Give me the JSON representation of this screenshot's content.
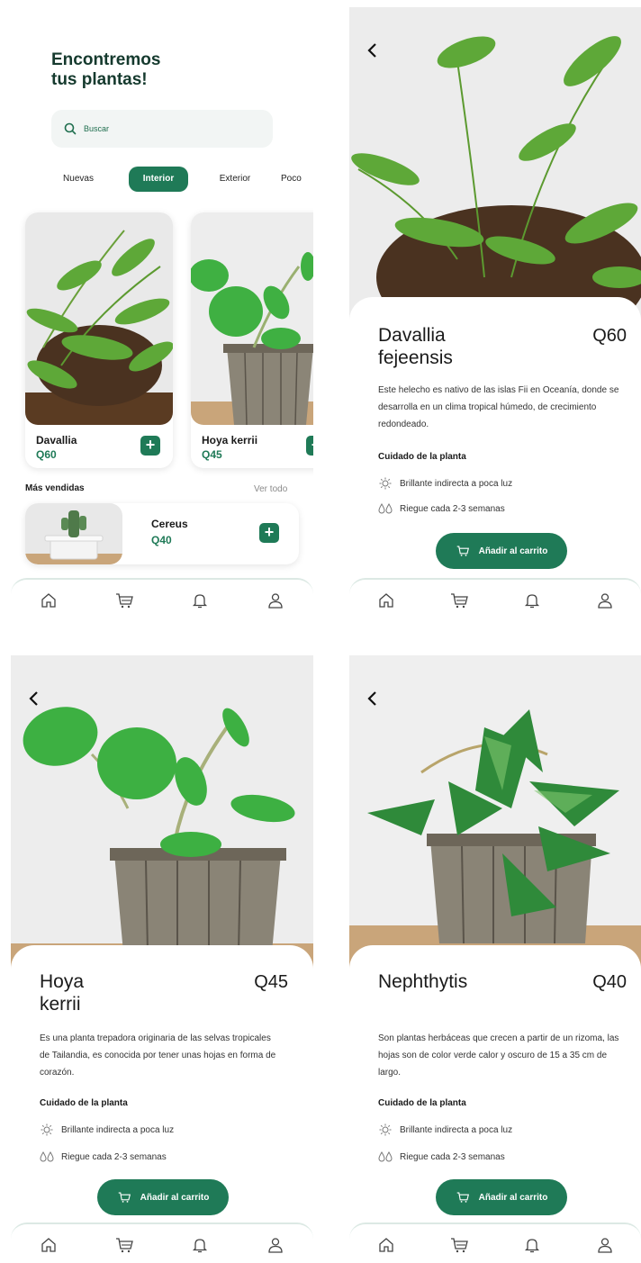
{
  "home": {
    "title_line1": "Encontremos",
    "title_line2": "tus plantas!",
    "search_placeholder": "Buscar",
    "tabs": [
      "Nuevas",
      "Interior",
      "Exterior",
      "Poco"
    ],
    "active_tab": "Interior",
    "cards": [
      {
        "name": "Davallia",
        "price": "Q60"
      },
      {
        "name": "Hoya kerrii",
        "price": "Q45"
      }
    ],
    "best_sellers_label": "Más vendidas",
    "see_all_label": "Ver todo",
    "best_seller": {
      "name": "Cereus",
      "price": "Q40"
    }
  },
  "details": [
    {
      "name_line1": "Davallia",
      "name_line2": "fejeensis",
      "price": "Q60",
      "description": "Este helecho es nativo de las islas Fii en Oceanía, donde se desarrolla en un clima tropical húmedo, de crecimiento redondeado.",
      "care_title": "Cuidado de la planta",
      "care_light": "Brillante indirecta a poca luz",
      "care_water": "Riegue cada 2-3 semanas",
      "cart_label": "Añadir al carrito"
    },
    {
      "name_line1": "Hoya",
      "name_line2": "kerrii",
      "price": "Q45",
      "description": "Es una planta trepadora originaria de las selvas tropicales de Tailandia, es conocida por tener unas hojas en forma de corazón.",
      "care_title": "Cuidado de la planta",
      "care_light": "Brillante indirecta a poca luz",
      "care_water": "Riegue cada 2-3 semanas",
      "cart_label": "Añadir al carrito"
    },
    {
      "name_line1": "Nephthytis",
      "name_line2": "",
      "price": "Q40",
      "description": "Son plantas herbáceas que crecen a partir de un rizoma, las hojas son de color verde calor y oscuro de 15 a 35 cm de largo.",
      "care_title": "Cuidado de la planta",
      "care_light": "Brillante indirecta a poca luz",
      "care_water": "Riegue cada 2-3 semanas",
      "cart_label": "Añadir al carrito"
    }
  ],
  "nav": [
    "home-icon",
    "cart-icon",
    "bell-icon",
    "user-icon"
  ],
  "colors": {
    "accent": "#1f7a57",
    "title": "#153a2e"
  }
}
